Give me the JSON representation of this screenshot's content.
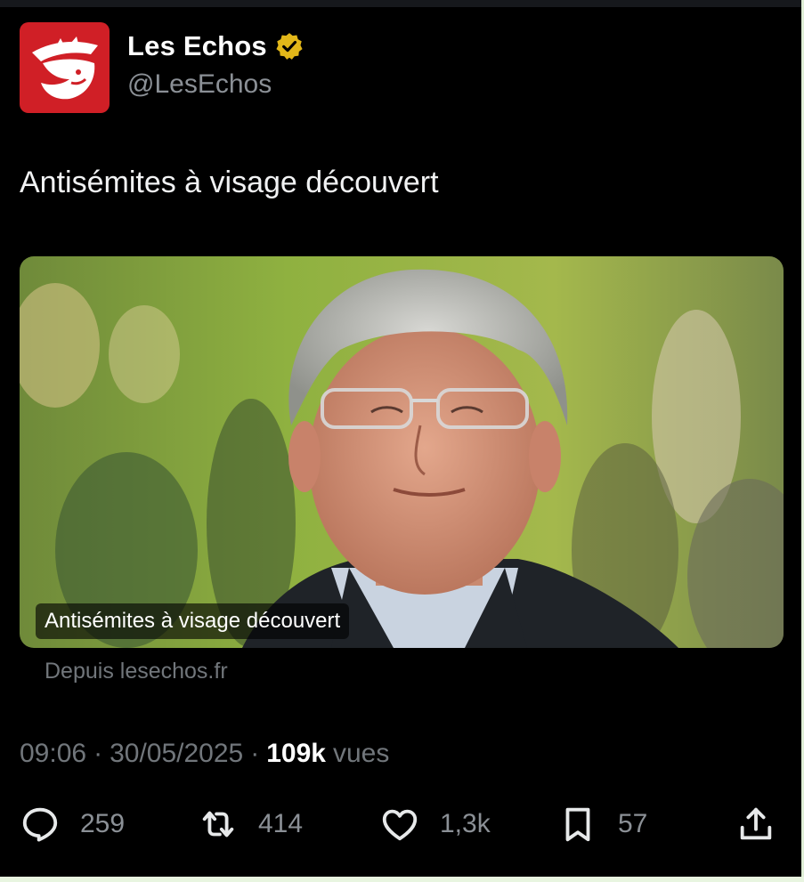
{
  "account": {
    "display_name": "Les Echos",
    "handle": "@LesEchos",
    "verified_badge_icon": "verified-gold-badge-icon",
    "avatar_color": "#d01f26"
  },
  "tweet": {
    "text": "Antisémites à visage découvert"
  },
  "card": {
    "caption": "Antisémites à visage découvert",
    "source": "Depuis lesechos.fr"
  },
  "meta": {
    "time": "09:06",
    "separator": "·",
    "date": "30/05/2025",
    "views_count": "109k",
    "views_label": "vues"
  },
  "actions": {
    "replies": {
      "icon": "reply-icon",
      "count": "259"
    },
    "reposts": {
      "icon": "repost-icon",
      "count": "414"
    },
    "likes": {
      "icon": "like-heart-icon",
      "count": "1,3k"
    },
    "bookmarks": {
      "icon": "bookmark-icon",
      "count": "57"
    },
    "share": {
      "icon": "share-icon"
    }
  },
  "colors": {
    "background": "#000000",
    "muted_text": "#71767b",
    "verified_gold": "#e2b719"
  }
}
